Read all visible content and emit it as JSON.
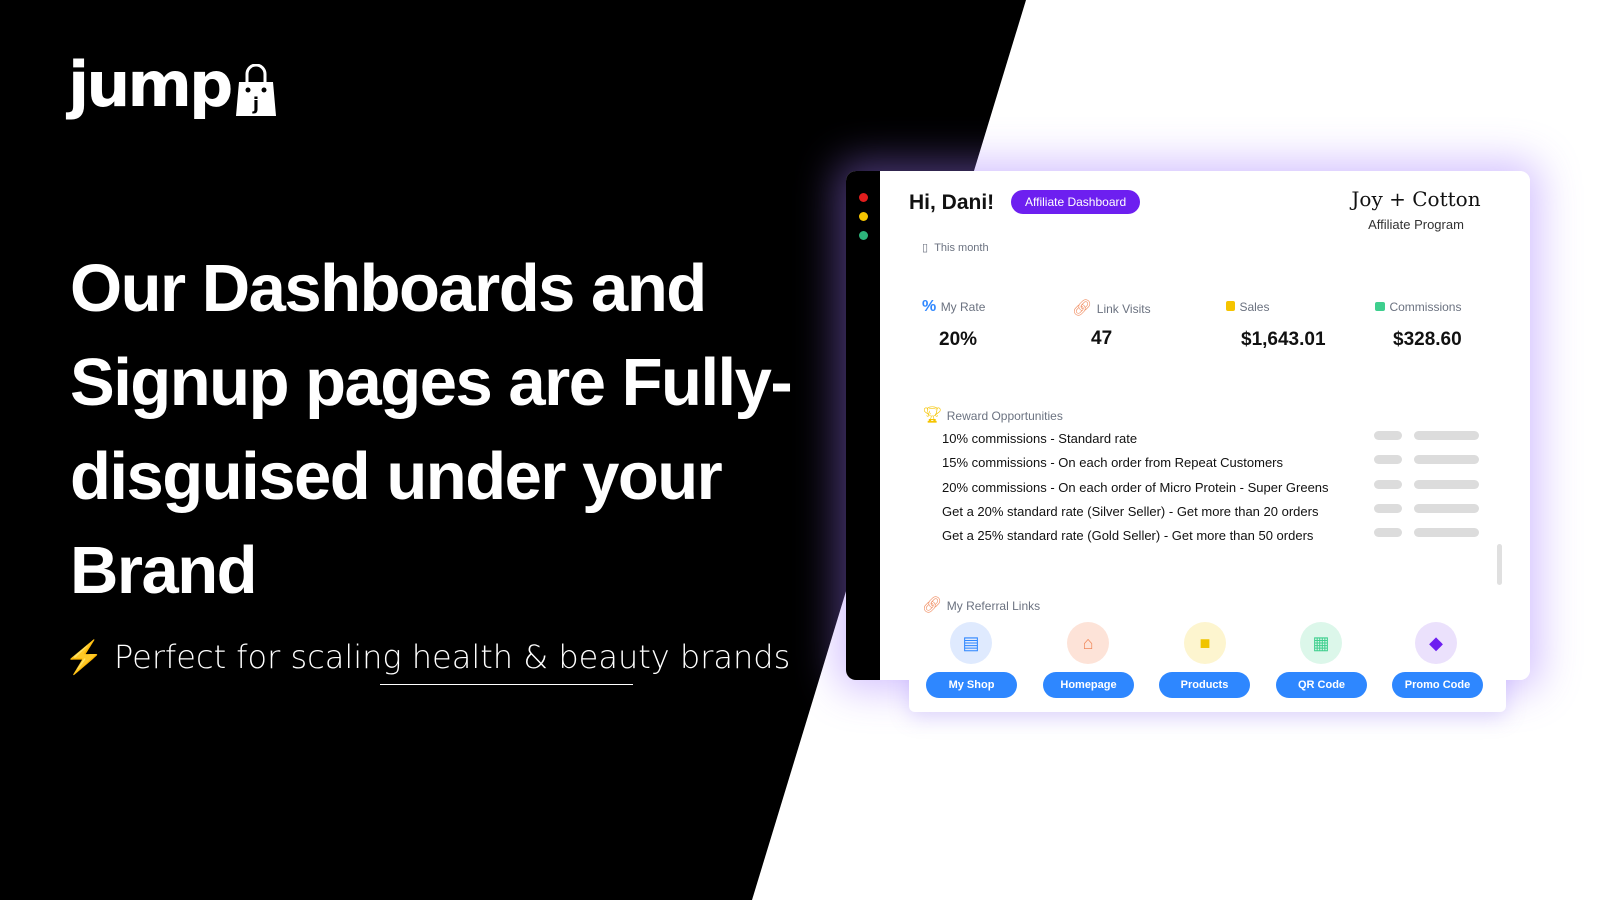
{
  "logo": {
    "text": "jump",
    "bag_letter": "j"
  },
  "headline": "Our Dashboards and Signup pages are Fully-disguised under your Brand",
  "tagline": {
    "icon": "lightning-icon",
    "text": "Perfect for scaling health & beauty brands"
  },
  "dashboard": {
    "window_dots": [
      "#e11d1d",
      "#f5c400",
      "#2db37a"
    ],
    "greeting": "Hi, Dani!",
    "badge": "Affiliate Dashboard",
    "brand_name": "Joy + Cotton",
    "brand_sub": "Affiliate Program",
    "period": "This month",
    "stats": [
      {
        "label": "My Rate",
        "value": "20%",
        "icon": "percent-icon",
        "color": "#2e87ff"
      },
      {
        "label": "Link Visits",
        "value": "47",
        "icon": "link-icon",
        "color": "#f08a5d"
      },
      {
        "label": "Sales",
        "value": "$1,643.01",
        "icon": "coins-icon",
        "color": "#f5c400"
      },
      {
        "label": "Commissions",
        "value": "$328.60",
        "icon": "wallet-icon",
        "color": "#3ecf8e"
      }
    ],
    "rewards_title": "Reward Opportunities",
    "rewards": [
      "10% commissions - Standard rate",
      "15% commissions - On each order from Repeat Customers",
      "20% commissions - On each order of Micro Protein - Super Greens",
      "Get a 20% standard rate (Silver Seller) - Get more than 20 orders",
      "Get a 25% standard rate (Gold Seller) - Get more than 50 orders"
    ],
    "links_title": "My Referral Links",
    "links": [
      {
        "label": "My Shop",
        "icon": "store-icon",
        "bg": "#dfeafe",
        "fg": "#2e87ff"
      },
      {
        "label": "Homepage",
        "icon": "home-icon",
        "bg": "#fde3d8",
        "fg": "#f08a5d"
      },
      {
        "label": "Products",
        "icon": "shopping-bag-icon",
        "bg": "#fdf5cf",
        "fg": "#f0c400"
      },
      {
        "label": "QR Code",
        "icon": "qr-code-icon",
        "bg": "#dcf7ea",
        "fg": "#3ecf8e"
      },
      {
        "label": "Promo Code",
        "icon": "tag-icon",
        "bg": "#ebe1fc",
        "fg": "#6d1ff0"
      }
    ]
  }
}
